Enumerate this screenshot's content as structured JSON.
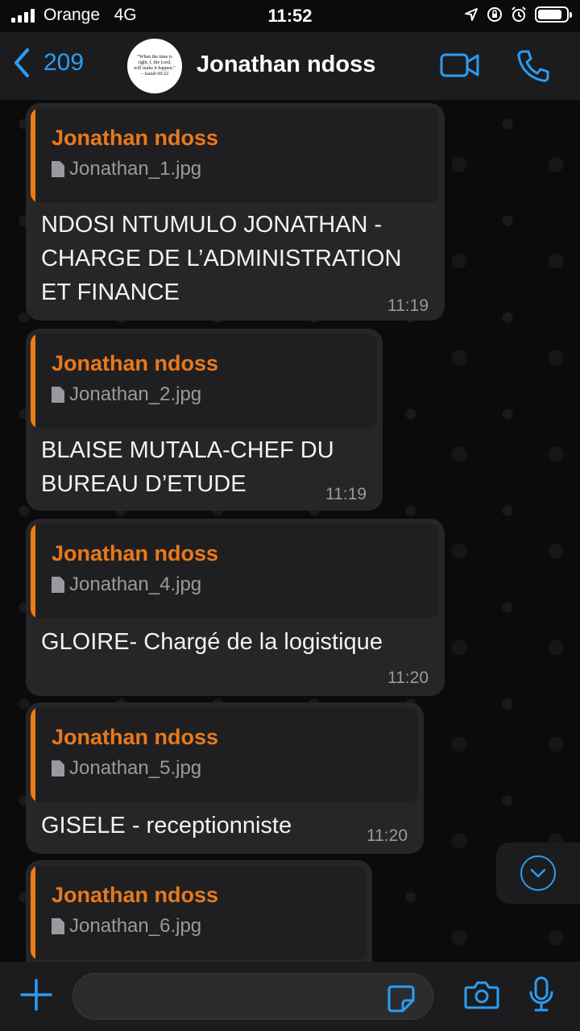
{
  "status": {
    "carrier": "Orange",
    "network": "4G",
    "time": "11:52",
    "battery_level": 0.85
  },
  "header": {
    "back_count": "209",
    "contact_name": "Jonathan ndoss",
    "avatar_text": "“When the time is right, I, the Lord, will make it happen.” – Isaiah 60:22"
  },
  "messages": [
    {
      "quote_name": "Jonathan ndoss",
      "quote_file": "Jonathan_1.jpg",
      "line1": "NDOSI NTUMULO JONATHAN -",
      "line2": "CHARGE DE L’ADMINISTRATION",
      "line3": "ET FINANCE",
      "time": "11:19"
    },
    {
      "quote_name": "Jonathan ndoss",
      "quote_file": "Jonathan_2.jpg",
      "line1": "BLAISE MUTALA-CHEF DU",
      "line2": "BUREAU D’ETUDE",
      "time": "11:19"
    },
    {
      "quote_name": "Jonathan ndoss",
      "quote_file": "Jonathan_4.jpg",
      "line1": "GLOIRE- Chargé de la logistique",
      "time": "11:20"
    },
    {
      "quote_name": "Jonathan ndoss",
      "quote_file": "Jonathan_5.jpg",
      "line1": "GISELE - receptionniste",
      "time": "11:20"
    },
    {
      "quote_name": "Jonathan ndoss",
      "quote_file": "Jonathan_6.jpg"
    }
  ],
  "colors": {
    "accent": "#2a9df4",
    "quote_bar": "#ee7a12",
    "quote_name": "#e8791d",
    "bubble": "#262628",
    "bar_bg": "#1c1c1e"
  },
  "icons": [
    "back-chevron-icon",
    "video-camera-icon",
    "phone-icon",
    "file-icon",
    "chevron-down-icon",
    "plus-icon",
    "sticker-icon",
    "camera-icon",
    "microphone-icon"
  ]
}
